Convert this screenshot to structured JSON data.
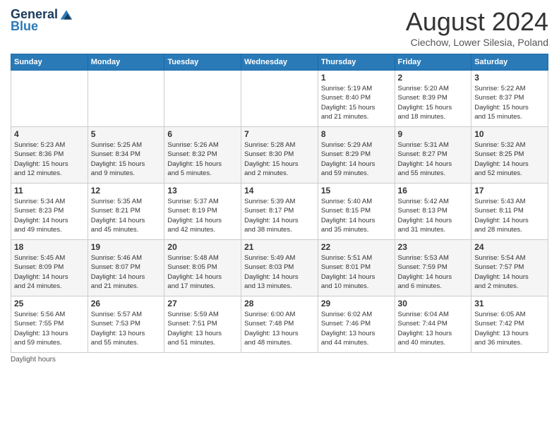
{
  "header": {
    "logo_general": "General",
    "logo_blue": "Blue",
    "month_year": "August 2024",
    "location": "Ciechow, Lower Silesia, Poland"
  },
  "days_of_week": [
    "Sunday",
    "Monday",
    "Tuesday",
    "Wednesday",
    "Thursday",
    "Friday",
    "Saturday"
  ],
  "weeks": [
    [
      {
        "day": "",
        "info": ""
      },
      {
        "day": "",
        "info": ""
      },
      {
        "day": "",
        "info": ""
      },
      {
        "day": "",
        "info": ""
      },
      {
        "day": "1",
        "info": "Sunrise: 5:19 AM\nSunset: 8:40 PM\nDaylight: 15 hours\nand 21 minutes."
      },
      {
        "day": "2",
        "info": "Sunrise: 5:20 AM\nSunset: 8:39 PM\nDaylight: 15 hours\nand 18 minutes."
      },
      {
        "day": "3",
        "info": "Sunrise: 5:22 AM\nSunset: 8:37 PM\nDaylight: 15 hours\nand 15 minutes."
      }
    ],
    [
      {
        "day": "4",
        "info": "Sunrise: 5:23 AM\nSunset: 8:36 PM\nDaylight: 15 hours\nand 12 minutes."
      },
      {
        "day": "5",
        "info": "Sunrise: 5:25 AM\nSunset: 8:34 PM\nDaylight: 15 hours\nand 9 minutes."
      },
      {
        "day": "6",
        "info": "Sunrise: 5:26 AM\nSunset: 8:32 PM\nDaylight: 15 hours\nand 5 minutes."
      },
      {
        "day": "7",
        "info": "Sunrise: 5:28 AM\nSunset: 8:30 PM\nDaylight: 15 hours\nand 2 minutes."
      },
      {
        "day": "8",
        "info": "Sunrise: 5:29 AM\nSunset: 8:29 PM\nDaylight: 14 hours\nand 59 minutes."
      },
      {
        "day": "9",
        "info": "Sunrise: 5:31 AM\nSunset: 8:27 PM\nDaylight: 14 hours\nand 55 minutes."
      },
      {
        "day": "10",
        "info": "Sunrise: 5:32 AM\nSunset: 8:25 PM\nDaylight: 14 hours\nand 52 minutes."
      }
    ],
    [
      {
        "day": "11",
        "info": "Sunrise: 5:34 AM\nSunset: 8:23 PM\nDaylight: 14 hours\nand 49 minutes."
      },
      {
        "day": "12",
        "info": "Sunrise: 5:35 AM\nSunset: 8:21 PM\nDaylight: 14 hours\nand 45 minutes."
      },
      {
        "day": "13",
        "info": "Sunrise: 5:37 AM\nSunset: 8:19 PM\nDaylight: 14 hours\nand 42 minutes."
      },
      {
        "day": "14",
        "info": "Sunrise: 5:39 AM\nSunset: 8:17 PM\nDaylight: 14 hours\nand 38 minutes."
      },
      {
        "day": "15",
        "info": "Sunrise: 5:40 AM\nSunset: 8:15 PM\nDaylight: 14 hours\nand 35 minutes."
      },
      {
        "day": "16",
        "info": "Sunrise: 5:42 AM\nSunset: 8:13 PM\nDaylight: 14 hours\nand 31 minutes."
      },
      {
        "day": "17",
        "info": "Sunrise: 5:43 AM\nSunset: 8:11 PM\nDaylight: 14 hours\nand 28 minutes."
      }
    ],
    [
      {
        "day": "18",
        "info": "Sunrise: 5:45 AM\nSunset: 8:09 PM\nDaylight: 14 hours\nand 24 minutes."
      },
      {
        "day": "19",
        "info": "Sunrise: 5:46 AM\nSunset: 8:07 PM\nDaylight: 14 hours\nand 21 minutes."
      },
      {
        "day": "20",
        "info": "Sunrise: 5:48 AM\nSunset: 8:05 PM\nDaylight: 14 hours\nand 17 minutes."
      },
      {
        "day": "21",
        "info": "Sunrise: 5:49 AM\nSunset: 8:03 PM\nDaylight: 14 hours\nand 13 minutes."
      },
      {
        "day": "22",
        "info": "Sunrise: 5:51 AM\nSunset: 8:01 PM\nDaylight: 14 hours\nand 10 minutes."
      },
      {
        "day": "23",
        "info": "Sunrise: 5:53 AM\nSunset: 7:59 PM\nDaylight: 14 hours\nand 6 minutes."
      },
      {
        "day": "24",
        "info": "Sunrise: 5:54 AM\nSunset: 7:57 PM\nDaylight: 14 hours\nand 2 minutes."
      }
    ],
    [
      {
        "day": "25",
        "info": "Sunrise: 5:56 AM\nSunset: 7:55 PM\nDaylight: 13 hours\nand 59 minutes."
      },
      {
        "day": "26",
        "info": "Sunrise: 5:57 AM\nSunset: 7:53 PM\nDaylight: 13 hours\nand 55 minutes."
      },
      {
        "day": "27",
        "info": "Sunrise: 5:59 AM\nSunset: 7:51 PM\nDaylight: 13 hours\nand 51 minutes."
      },
      {
        "day": "28",
        "info": "Sunrise: 6:00 AM\nSunset: 7:48 PM\nDaylight: 13 hours\nand 48 minutes."
      },
      {
        "day": "29",
        "info": "Sunrise: 6:02 AM\nSunset: 7:46 PM\nDaylight: 13 hours\nand 44 minutes."
      },
      {
        "day": "30",
        "info": "Sunrise: 6:04 AM\nSunset: 7:44 PM\nDaylight: 13 hours\nand 40 minutes."
      },
      {
        "day": "31",
        "info": "Sunrise: 6:05 AM\nSunset: 7:42 PM\nDaylight: 13 hours\nand 36 minutes."
      }
    ]
  ],
  "footer": "Daylight hours"
}
